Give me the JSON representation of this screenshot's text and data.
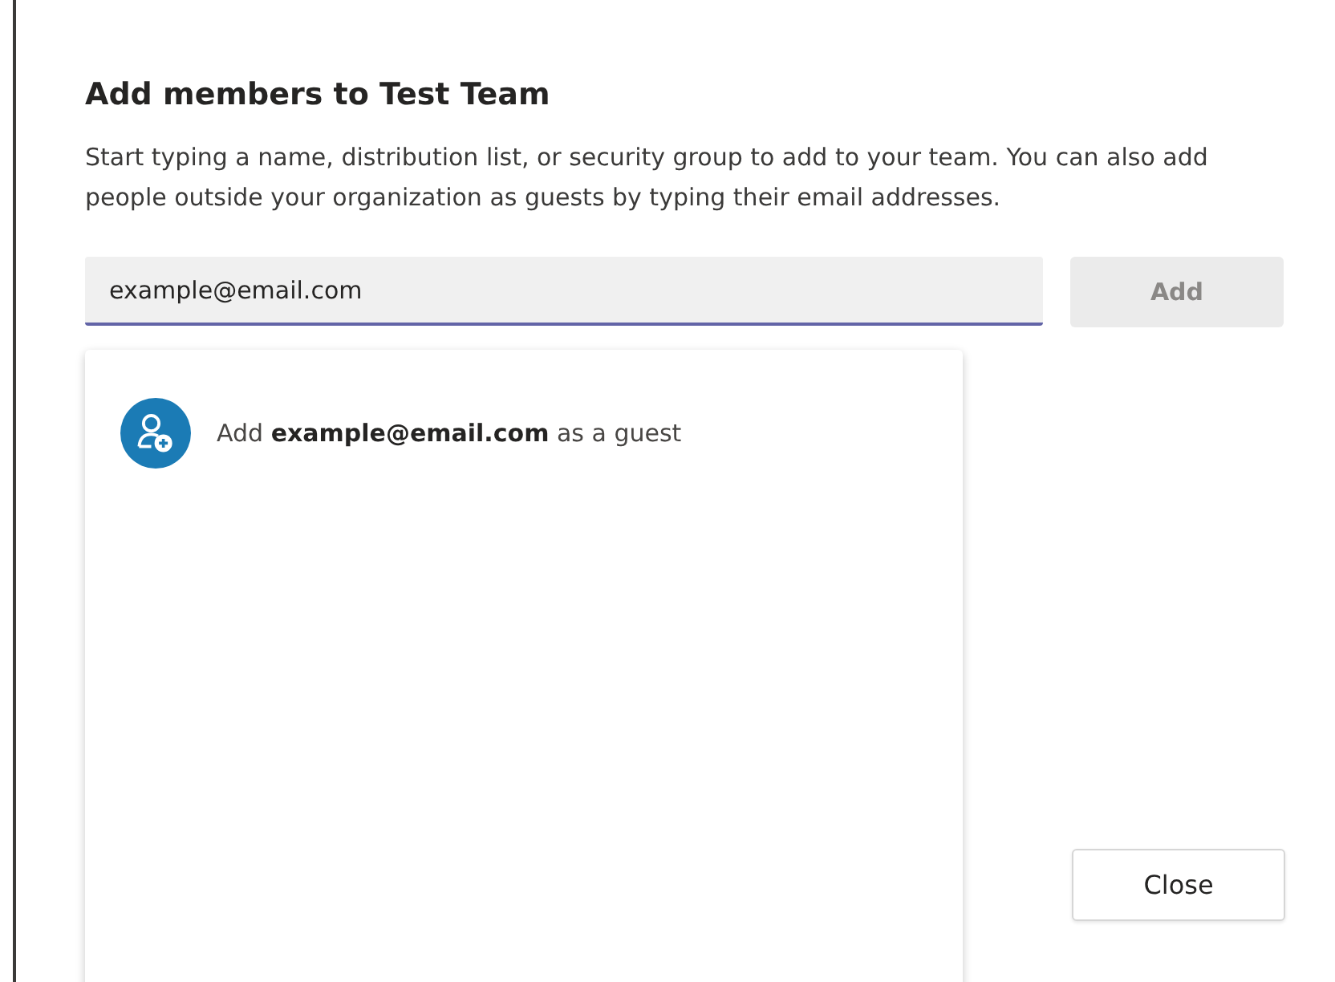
{
  "dialog": {
    "title": "Add members to Test Team",
    "description": "Start typing a name, distribution list, or security group to add to your team. You can also add people outside your organization as guests by typing their email addresses.",
    "search": {
      "value": "example@email.com"
    },
    "add_button": {
      "label": "Add",
      "disabled": true
    },
    "suggestions": [
      {
        "text": "Add **example@email.com** as a guest"
      }
    ],
    "close_button": {
      "label": "Close"
    }
  }
}
